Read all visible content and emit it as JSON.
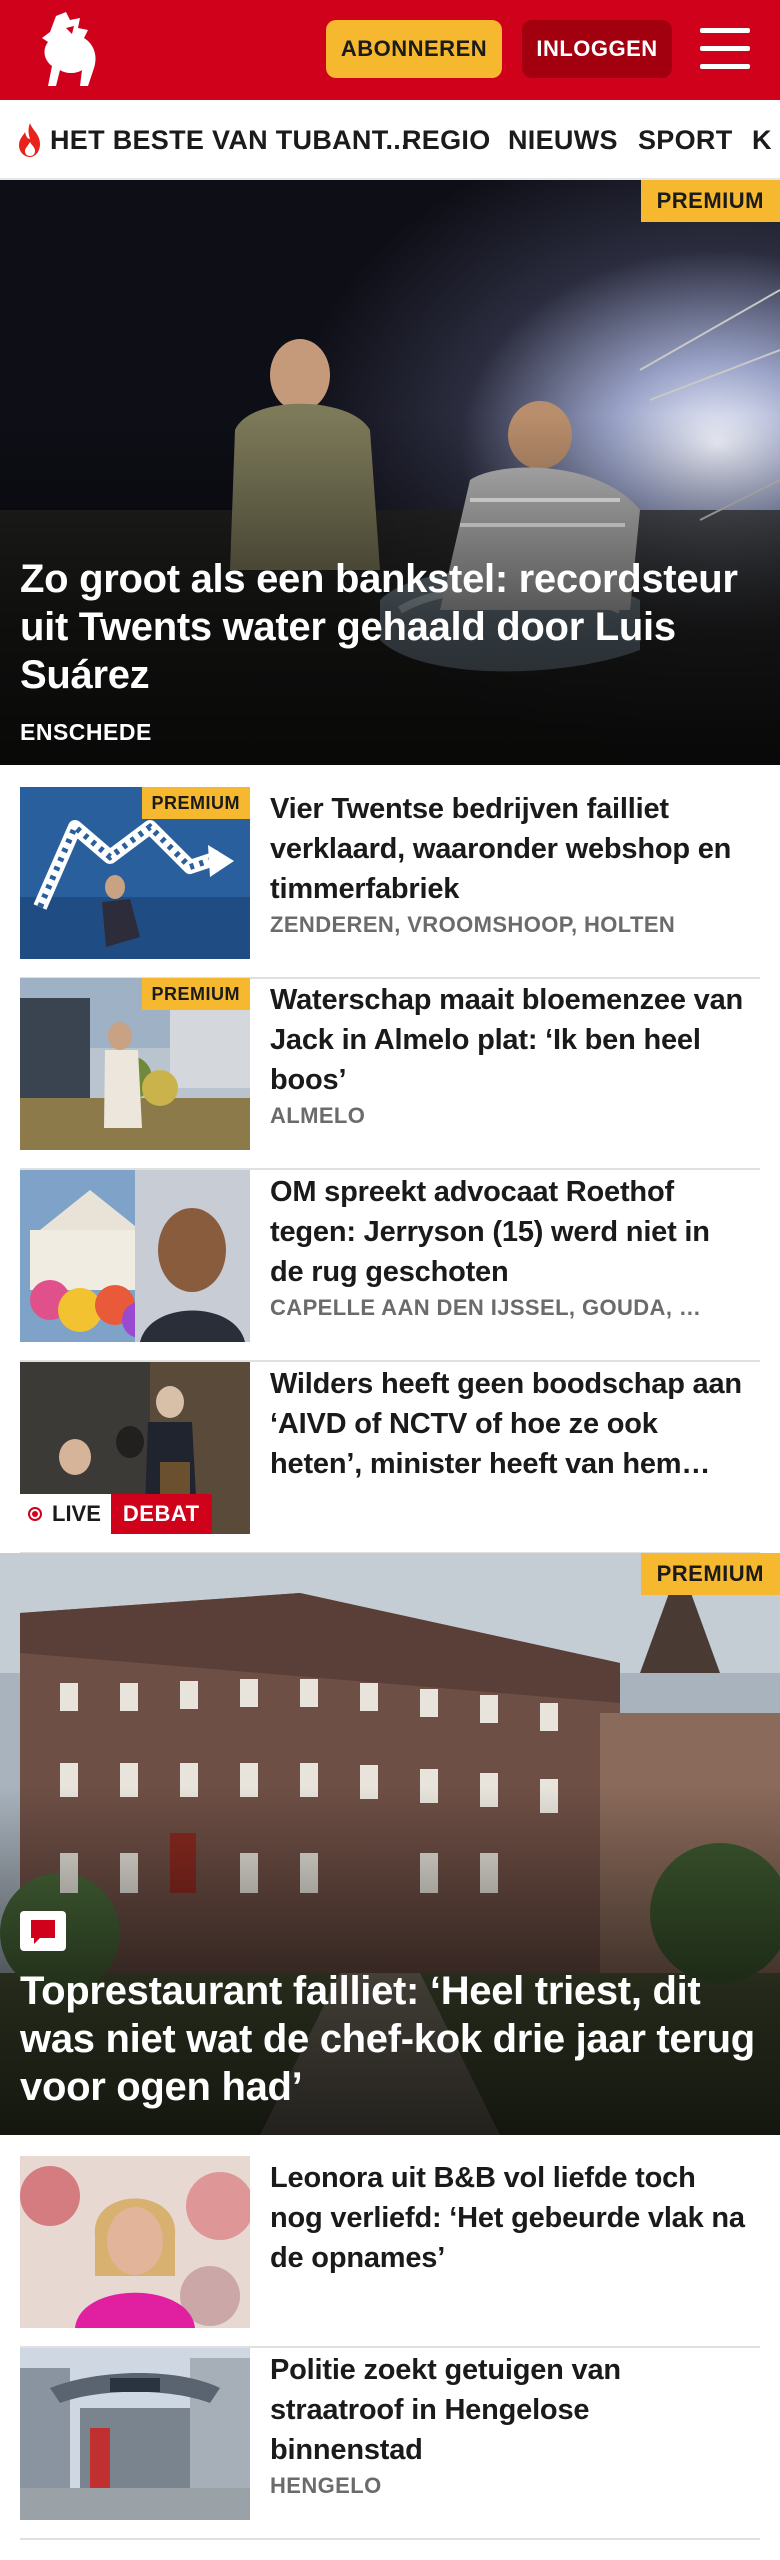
{
  "header": {
    "subscribe_label": "ABONNEREN",
    "login_label": "INLOGGEN",
    "brand_color": "#d0021b",
    "accent_color": "#f5b82e",
    "logo_icon": "horse-logo-icon",
    "menu_icon": "hamburger-menu-icon"
  },
  "nav": {
    "items": [
      {
        "label": "HET BESTE VAN TUBANT..."
      },
      {
        "label": "REGIO"
      },
      {
        "label": "NIEUWS"
      },
      {
        "label": "SPORT"
      },
      {
        "label": "K"
      }
    ]
  },
  "hero1": {
    "badge": "PREMIUM",
    "title": "Zo groot als een bankstel: recordsteur uit Twents water gehaald door Luis Suárez",
    "location": "ENSCHEDE"
  },
  "articles": [
    {
      "badge": "PREMIUM",
      "title": "Vier Twentse bedrijven failliet verklaard, waaronder webshop en timmerfabriek",
      "location": "ZENDEREN, VROOMSHOOP, HOLTEN"
    },
    {
      "badge": "PREMIUM",
      "title": "Waterschap maait bloemenzee van Jack in Almelo plat: ‘Ik ben heel boos’",
      "location": "ALMELO"
    },
    {
      "title": "OM spreekt advocaat Roethof tegen: Jerryson (15) werd niet in de rug geschoten",
      "location": "CAPELLE AAN DEN IJSSEL, GOUDA, …"
    },
    {
      "title": "Wilders heeft geen boodschap aan ‘AIVD of NCTV of hoe ze ook heten’, minister heeft van hem…",
      "live_label": "LIVE",
      "debat_label": "DEBAT"
    }
  ],
  "hero2": {
    "badge": "PREMIUM",
    "title": "Toprestaurant failliet: ‘Heel triest, dit was niet wat de chef-kok drie jaar terug voor ogen had’",
    "comment_icon": "comment-icon"
  },
  "articles2": [
    {
      "title": "Leonora uit B&B vol liefde toch nog verliefd: ‘Het gebeurde vlak na de opnames’"
    },
    {
      "title": "Politie zoekt getuigen van straatroof in Hengelose binnenstad",
      "location": "HENGELO"
    }
  ]
}
